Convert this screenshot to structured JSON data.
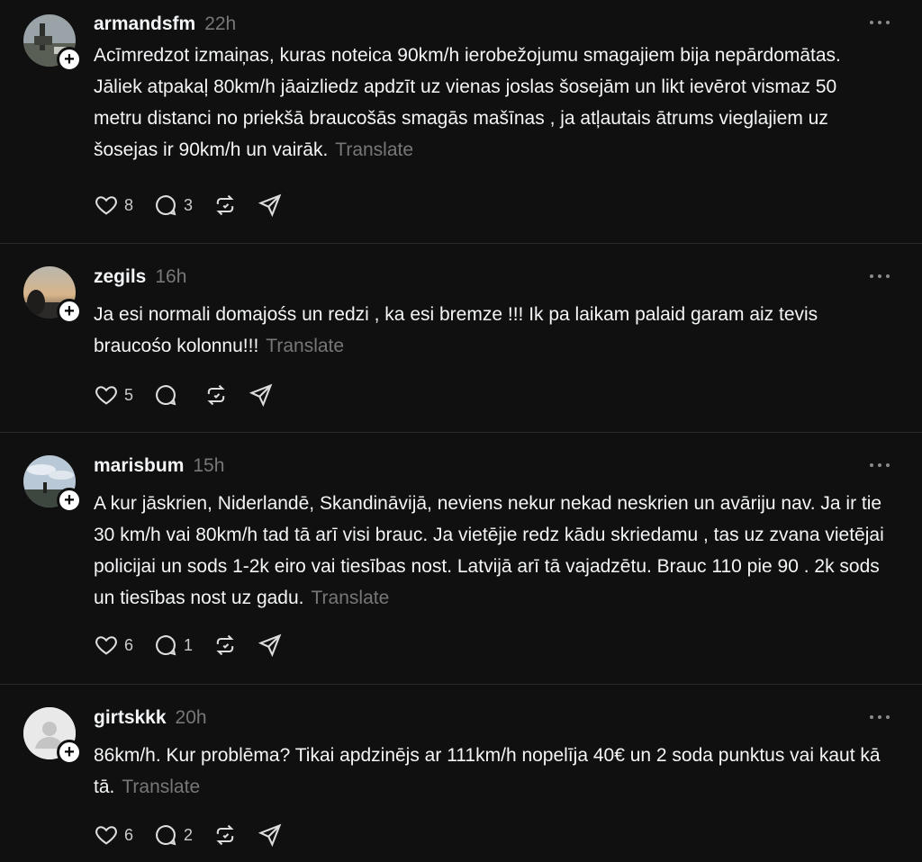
{
  "posts": [
    {
      "username": "armandsfm",
      "time": "22h",
      "text": "Acīmredzot izmaiņas, kuras noteica 90km/h ierobežojumu smagajiem bija nepārdomātas. Jāliek atpakaļ 80km/h jāaizliedz apdzīt uz vienas joslas šosejām un likt ievērot vismaz 50 metru distanci no priekšā braucošās smagās mašīnas , ja atļautais ātrums vieglajiem uz šosejas ir 90km/h un vairāk.",
      "translate": "Translate",
      "likes": "8",
      "replies": "3",
      "avatar": "landscape-photo"
    },
    {
      "username": "zegils",
      "time": "16h",
      "text": "Ja esi normali domajośs un redzi , ka esi bremze !!! Ik pa laikam palaid garam aiz tevis braucośo kolonnu!!!",
      "translate": "Translate",
      "likes": "5",
      "replies": "",
      "avatar": "sunset-photo"
    },
    {
      "username": "marisbum",
      "time": "15h",
      "text": "A kur jāskrien, Niderlandē, Skandināvijā, neviens nekur nekad neskrien un avāriju nav. Ja ir tie 30 km/h vai 80km/h tad tā arī visi brauc. Ja vietējie redz kādu skriedamu , tas uz zvana vietējai policijai un sods 1-2k eiro vai tiesības nost. Latvijā arī tā vajadzētu. Brauc 110 pie 90 . 2k sods un tiesības nost uz gadu.",
      "translate": "Translate",
      "likes": "6",
      "replies": "1",
      "avatar": "sky-photo"
    },
    {
      "username": "girtskkk",
      "time": "20h",
      "text": "86km/h. Kur problēma? Tikai apdzinējs ar 111km/h nopelīja 40€ un 2 soda punktus vai kaut kā tā.",
      "translate": "Translate",
      "likes": "6",
      "replies": "2",
      "avatar": "default-user"
    }
  ],
  "icons": {
    "like": "heart-icon",
    "reply": "comment-bubble-icon",
    "repost": "repost-icon",
    "share": "send-icon",
    "more": "more-dots-icon",
    "follow": "plus-icon"
  },
  "colors": {
    "background": "#101010",
    "text": "#f3f5f7",
    "muted": "#777777",
    "divider": "#2a2a2a"
  }
}
